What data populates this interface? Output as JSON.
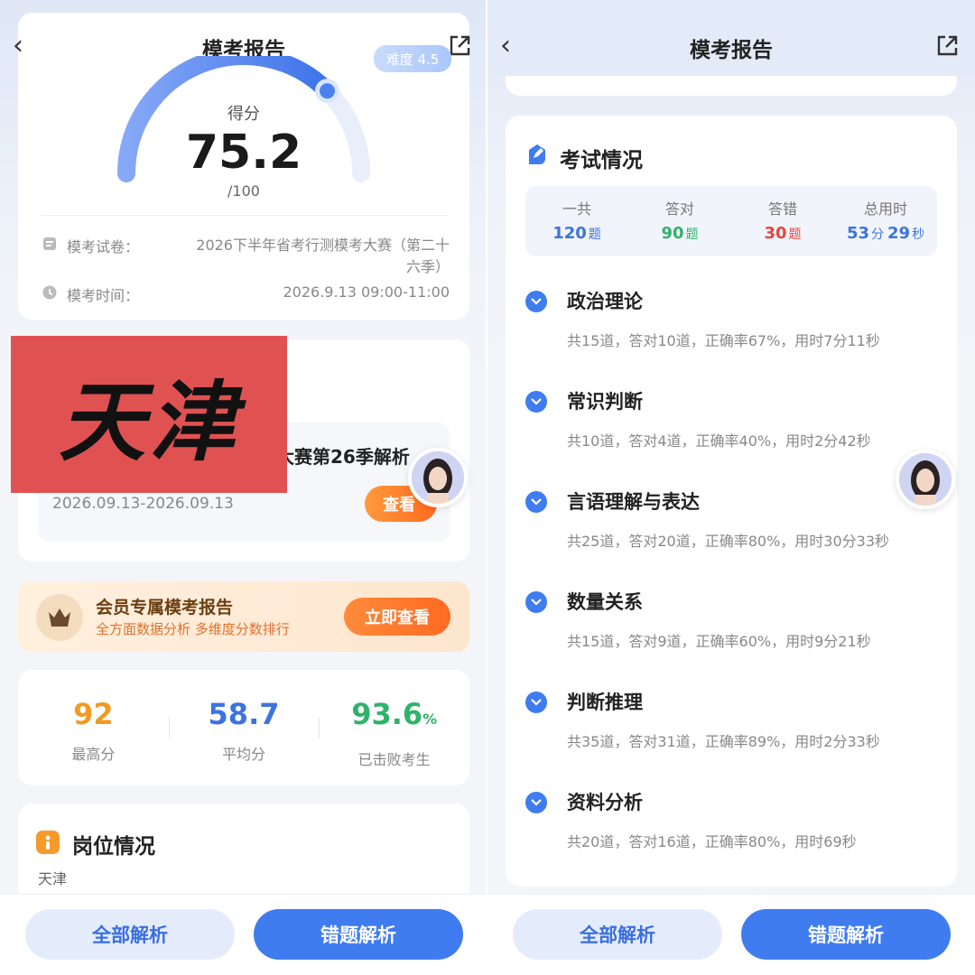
{
  "header": {
    "title": "模考报告",
    "back_glyph": "‹"
  },
  "left": {
    "difficulty": "难度 4.5",
    "score_label": "得分",
    "score_value": "75.2",
    "score_total": "/100",
    "score_fraction": 0.752,
    "paper_label": "模考试卷：",
    "paper_value_line1": "2026下半年省考行测模考大赛（第二十",
    "paper_value_line2": "六季）",
    "time_label": "模考时间：",
    "time_value": "2026.9.13 09:00-11:00",
    "stamp_text": "天津",
    "course_title_partial": "大赛第26季解析",
    "course_date": "2026.09.13-2026.09.13",
    "course_button": "查看",
    "vip_title": "会员专属模考报告",
    "vip_sub": "全方面数据分析 多维度分数排行",
    "vip_button": "立即查看",
    "stats": [
      {
        "value": "92",
        "unit": "",
        "label": "最高分",
        "color": "#f29a1f"
      },
      {
        "value": "58.7",
        "unit": "",
        "label": "平均分",
        "color": "#3d73e0"
      },
      {
        "value": "93.6",
        "unit": "%",
        "label": "已击败考生",
        "color": "#2fb36a"
      }
    ],
    "position_title": "岗位情况",
    "position_value": "天津"
  },
  "right": {
    "exam_title": "考试情况",
    "summary": [
      {
        "label": "一共",
        "value": "120",
        "unit": "题",
        "value2": "",
        "unit2": "",
        "color": "#3d73e0"
      },
      {
        "label": "答对",
        "value": "90",
        "unit": "题",
        "value2": "",
        "unit2": "",
        "color": "#2fb36a"
      },
      {
        "label": "答错",
        "value": "30",
        "unit": "题",
        "value2": "",
        "unit2": "",
        "color": "#e5463b"
      },
      {
        "label": "总用时",
        "value": "53",
        "unit": "分",
        "value2": "29",
        "unit2": "秒",
        "color": "#3d73e0"
      }
    ],
    "sections": [
      {
        "name": "政治理论",
        "detail": "共15道，答对10道，正确率67%，用时7分11秒"
      },
      {
        "name": "常识判断",
        "detail": "共10道，答对4道，正确率40%，用时2分42秒"
      },
      {
        "name": "言语理解与表达",
        "detail": "共25道，答对20道，正确率80%，用时30分33秒"
      },
      {
        "name": "数量关系",
        "detail": "共15道，答对9道，正确率60%，用时9分21秒"
      },
      {
        "name": "判断推理",
        "detail": "共35道，答对31道，正确率89%，用时2分33秒"
      },
      {
        "name": "资料分析",
        "detail": "共20道，答对16道，正确率80%，用时69秒"
      }
    ]
  },
  "bottom": {
    "all_label": "全部解析",
    "wrong_label": "错题解析"
  },
  "icons": {
    "back": "chevron-left-icon",
    "share": "share-icon",
    "paper": "document-icon",
    "clock": "clock-icon",
    "crown": "crown-icon",
    "check": "check-circle-icon",
    "pencil": "edit-icon",
    "badge": "info-badge-icon"
  },
  "colors": {
    "accent": "#3f7cf0",
    "stamp": "#e05252"
  }
}
